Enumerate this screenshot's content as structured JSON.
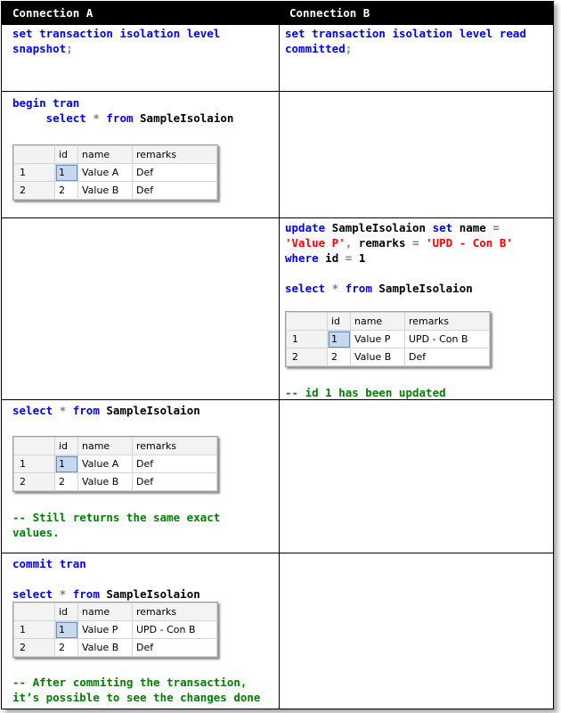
{
  "headers": {
    "a": "Connection A",
    "b": "Connection B"
  },
  "sql": {
    "set": "set",
    "transaction": "transaction",
    "isolation": "isolation",
    "level": "level",
    "snapshot": "snapshot",
    "read": "read",
    "committed": "committed",
    "begin": "begin",
    "tran": "tran",
    "select": "select",
    "star": "*",
    "from": "from",
    "table_name": "SampleIsolaion",
    "update": "update",
    "name_col": "name",
    "eq": "=",
    "value_p": "'Value P'",
    "comma": ",",
    "remarks_col": "remarks",
    "upd_con_b": "'UPD - Con B'",
    "where": "where",
    "id_col": "id",
    "one": "1",
    "commit": "commit",
    "semicolon": ";"
  },
  "comments": {
    "updated": "-- id 1 has been updated",
    "still_1": "-- Still returns the same exact",
    "still_2": "values.",
    "after_1": "-- After commiting the transaction,",
    "after_2": "it’s possible to see the changes done"
  },
  "results": {
    "columns": [
      "",
      "id",
      "name",
      "remarks"
    ],
    "before": [
      [
        "1",
        "1",
        "Value A",
        "Def"
      ],
      [
        "2",
        "2",
        "Value B",
        "Def"
      ]
    ],
    "after": [
      [
        "1",
        "1",
        "Value P",
        "UPD - Con B"
      ],
      [
        "2",
        "2",
        "Value B",
        "Def"
      ]
    ]
  },
  "colors": {
    "keyword": "#0000ff",
    "string": "#ff0000",
    "comment": "#008000",
    "header_bg": "#000000",
    "selected_cell": "#c6d7ef"
  }
}
